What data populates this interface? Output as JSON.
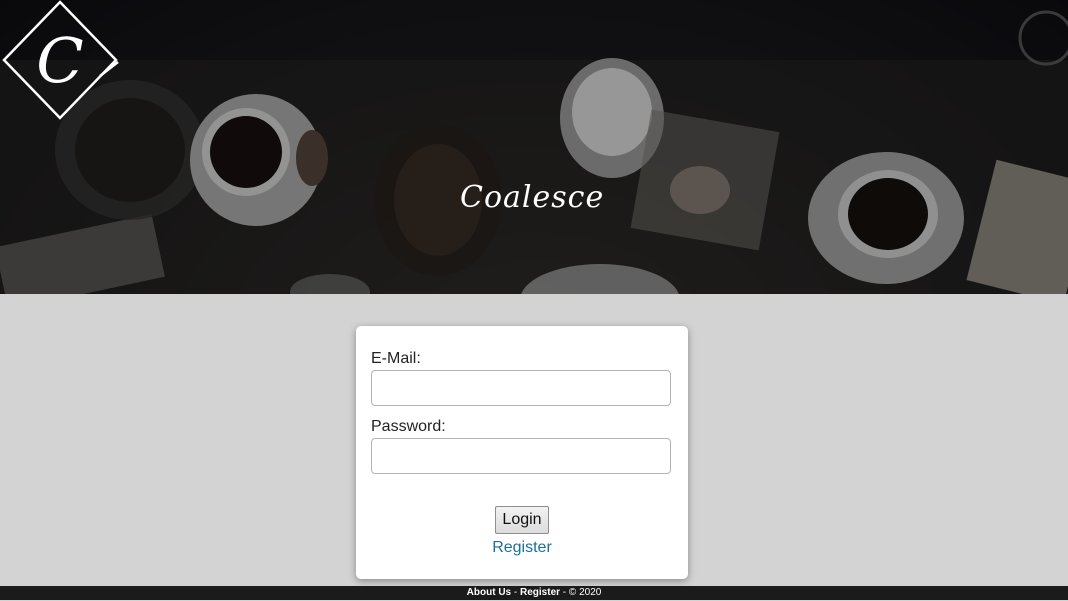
{
  "brand": {
    "logo_letter": "C",
    "name": "Coalesce"
  },
  "login_form": {
    "email_label": "E-Mail:",
    "email_value": "",
    "password_label": "Password:",
    "password_value": "",
    "login_button": "Login",
    "register_link": "Register"
  },
  "footer": {
    "about_link": "About Us",
    "separator_1": " - ",
    "register_link": "Register",
    "separator_2": " - ",
    "copyright": "© 2020"
  },
  "colors": {
    "page_background": "#d3d3d3",
    "link": "#1a6fa0",
    "footer_background": "#1b1b1b"
  }
}
